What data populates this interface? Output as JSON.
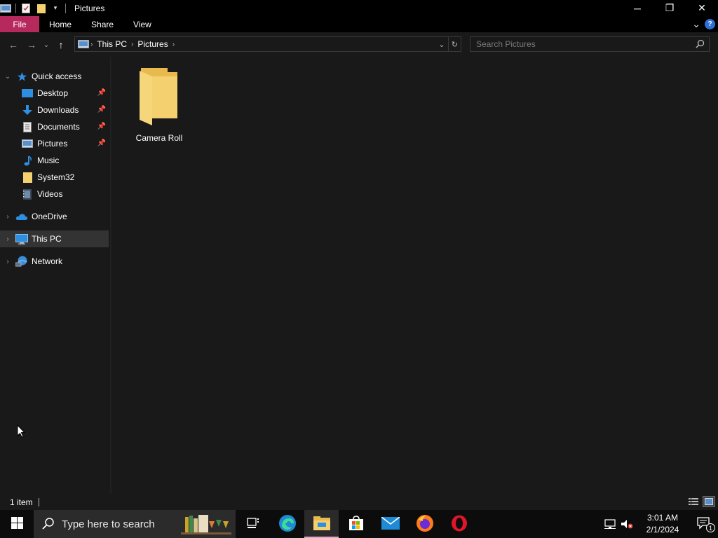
{
  "window": {
    "title": "Pictures",
    "controls": {
      "minimize": "─",
      "maximize": "❐",
      "close": "✕"
    }
  },
  "ribbon": {
    "tabs": [
      {
        "label": "File"
      },
      {
        "label": "Home"
      },
      {
        "label": "Share"
      },
      {
        "label": "View"
      }
    ],
    "expand_glyph": "⌄",
    "help_glyph": "?"
  },
  "navigation": {
    "back_glyph": "←",
    "forward_glyph": "→",
    "recent_glyph": "⌄",
    "up_glyph": "↑"
  },
  "address_bar": {
    "breadcrumbs": [
      "This PC",
      "Pictures"
    ],
    "separator": "›",
    "dropdown_glyph": "⌄",
    "refresh_glyph": "↻"
  },
  "search": {
    "placeholder": "Search Pictures"
  },
  "nav_pane": {
    "quick_access": "Quick access",
    "quick_items": [
      {
        "label": "Desktop",
        "pinned": true
      },
      {
        "label": "Downloads",
        "pinned": true
      },
      {
        "label": "Documents",
        "pinned": true
      },
      {
        "label": "Pictures",
        "pinned": true
      },
      {
        "label": "Music",
        "pinned": false
      },
      {
        "label": "System32",
        "pinned": false
      },
      {
        "label": "Videos",
        "pinned": false
      }
    ],
    "onedrive": "OneDrive",
    "this_pc": "This PC",
    "network": "Network",
    "selected": "This PC"
  },
  "content": {
    "items": [
      {
        "name": "Camera Roll",
        "type": "folder"
      }
    ]
  },
  "status_bar": {
    "item_count": "1 item"
  },
  "taskbar": {
    "search_text": "Type here to search",
    "apps": [
      "task-view",
      "edge",
      "file-explorer",
      "microsoft-store",
      "mail",
      "firefox",
      "opera"
    ],
    "active_app": "file-explorer",
    "clock_time": "3:01 AM",
    "clock_date": "2/1/2024",
    "notification_count": "1"
  },
  "colors": {
    "file_tab": "#b6295c",
    "background": "#191919",
    "folder": "#f4d06f",
    "accent_blue": "#2e8fe0"
  }
}
